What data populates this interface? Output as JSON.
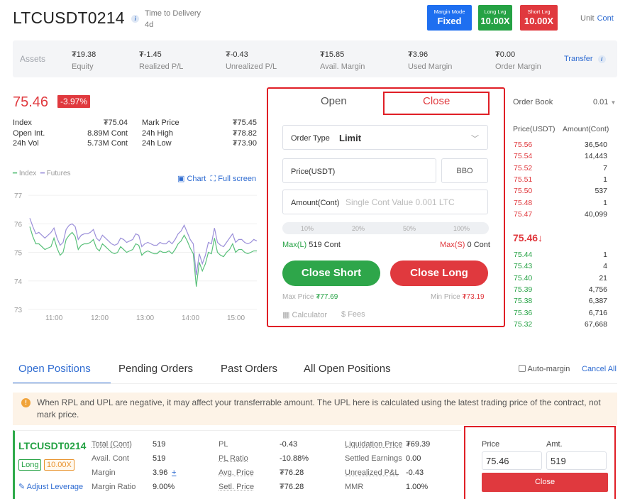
{
  "header": {
    "symbol": "LTCUSDT0214",
    "time_label": "Time to Delivery",
    "time_value": "4d",
    "margin_mode_label": "Margin Mode",
    "margin_mode_value": "Fixed",
    "long_lvg_label": "Long Lvg",
    "long_lvg_value": "10.00X",
    "short_lvg_label": "Short Lvg",
    "short_lvg_value": "10.00X",
    "unit_label": "Unit",
    "unit_value": "Cont"
  },
  "assets": {
    "label": "Assets",
    "items": [
      {
        "value": "₮19.38",
        "label": "Equity"
      },
      {
        "value": "₮-1.45",
        "label": "Realized P/L"
      },
      {
        "value": "₮-0.43",
        "label": "Unrealized P/L"
      },
      {
        "value": "₮15.85",
        "label": "Avail. Margin"
      },
      {
        "value": "₮3.96",
        "label": "Used Margin"
      },
      {
        "value": "₮0.00",
        "label": "Order Margin"
      }
    ],
    "transfer": "Transfer"
  },
  "ticker": {
    "price": "75.46",
    "change": "-3.97%",
    "index_label": "Index",
    "index": "₮75.04",
    "mark_label": "Mark Price",
    "mark": "₮75.45",
    "oi_label": "Open Int.",
    "oi": "8.89M Cont",
    "high_label": "24h High",
    "high": "₮78.82",
    "vol_label": "24h Vol",
    "vol": "5.73M Cont",
    "low_label": "24h Low",
    "low": "₮73.90"
  },
  "chart_legend": {
    "index": "Index",
    "futures": "Futures",
    "chart": "Chart",
    "fullscreen": "Full screen"
  },
  "chart_data": {
    "type": "line",
    "x": [
      "11:00",
      "12:00",
      "13:00",
      "14:00",
      "15:00"
    ],
    "yticks": [
      "77",
      "76",
      "75",
      "74",
      "73"
    ],
    "ylim": [
      73,
      77.3
    ],
    "series": [
      {
        "name": "Index",
        "color": "#59c07a",
        "values": [
          75.9,
          75.55,
          75.3,
          75.3,
          75.2,
          75.1,
          75.15,
          75.2,
          75.5,
          75.15,
          74.9,
          75.0,
          75.45,
          75.6,
          75.7,
          75.55,
          75.1,
          75.25,
          75.3,
          75.3,
          75.35,
          75.45,
          75.15,
          75.05,
          75.3,
          75.2,
          75.1,
          75.0,
          74.95,
          75.0,
          75.2,
          75.1,
          75.0,
          75.05,
          75.1,
          75.3,
          75.25,
          74.9,
          75.0,
          75.05,
          75.0,
          74.95,
          74.95,
          75.05,
          75.0,
          75.0,
          75.05,
          74.95,
          75.1,
          75.3,
          75.4,
          75.6,
          75.4,
          75.15,
          74.95,
          73.8,
          74.65,
          74.35,
          74.6,
          75.0,
          74.95,
          75.5,
          75.0,
          74.9,
          74.85,
          75.0,
          75.1,
          75.3,
          75.0,
          75.1,
          75.1,
          75.0,
          74.95,
          75.0,
          75.05,
          75.05
        ]
      },
      {
        "name": "Futures",
        "color": "#9b8fd9",
        "values": [
          76.2,
          75.9,
          75.65,
          75.7,
          75.6,
          75.5,
          75.6,
          75.7,
          75.85,
          75.5,
          75.25,
          75.35,
          75.8,
          75.95,
          76.0,
          75.9,
          75.45,
          75.6,
          75.65,
          75.65,
          75.7,
          75.8,
          75.5,
          75.4,
          75.6,
          75.5,
          75.4,
          75.3,
          75.25,
          75.3,
          75.5,
          75.45,
          75.35,
          75.4,
          75.45,
          75.65,
          75.6,
          75.2,
          75.3,
          75.35,
          75.3,
          75.25,
          75.25,
          75.35,
          75.3,
          75.3,
          75.4,
          75.3,
          75.45,
          75.65,
          75.75,
          75.95,
          75.7,
          75.45,
          75.3,
          74.2,
          74.95,
          74.6,
          74.9,
          75.35,
          75.3,
          75.85,
          75.35,
          75.25,
          75.2,
          75.35,
          75.5,
          75.65,
          75.35,
          75.45,
          75.45,
          75.35,
          75.3,
          75.35,
          75.45,
          75.4
        ]
      }
    ]
  },
  "order_panel": {
    "tab_open": "Open",
    "tab_close": "Close",
    "order_type_label": "Order Type",
    "order_type_value": "Limit",
    "price_label": "Price(USDT)",
    "bbo": "BBO",
    "amount_label": "Amount(Cont)",
    "amount_placeholder": "Single Cont Value 0.001 LTC",
    "pcts": [
      "10%",
      "20%",
      "50%",
      "100%"
    ],
    "max_l_label": "Max(L)",
    "max_l": "519 Cont",
    "max_s_label": "Max(S)",
    "max_s": "0 Cont",
    "close_short": "Close Short",
    "close_long": "Close Long",
    "max_price_label": "Max Price",
    "max_price": "₮77.69",
    "min_price_label": "Min Price",
    "min_price": "₮73.19",
    "calculator": "Calculator",
    "fees": "Fees"
  },
  "order_book": {
    "title": "Order Book",
    "precision": "0.01",
    "col_price": "Price(USDT)",
    "col_amount": "Amount(Cont)",
    "asks": [
      [
        "75.56",
        "36,540"
      ],
      [
        "75.54",
        "14,443"
      ],
      [
        "75.52",
        "7"
      ],
      [
        "75.51",
        "1"
      ],
      [
        "75.50",
        "537"
      ],
      [
        "75.48",
        "1"
      ],
      [
        "75.47",
        "40,099"
      ]
    ],
    "last": "75.46",
    "bids": [
      [
        "75.44",
        "1"
      ],
      [
        "75.43",
        "4"
      ],
      [
        "75.40",
        "21"
      ],
      [
        "75.39",
        "4,756"
      ],
      [
        "75.38",
        "6,387"
      ],
      [
        "75.36",
        "6,716"
      ],
      [
        "75.32",
        "67,668"
      ]
    ]
  },
  "positions": {
    "tabs": [
      "Open Positions",
      "Pending Orders",
      "Past Orders",
      "All Open Positions"
    ],
    "auto_margin": "Auto-margin",
    "cancel_all": "Cancel All",
    "notice": "When RPL and UPL are negative, it may affect your transferrable amount. The UPL here is calculated using the latest trading price of the contract, not mark price.",
    "symbol": "LTCUSDT0214",
    "side": "Long",
    "lev": "10.00X",
    "adjust": "Adjust Leverage",
    "fields": [
      [
        [
          "Total (Cont)",
          "519"
        ],
        [
          "Avail. Cont",
          "519"
        ],
        [
          "Margin",
          "3.96"
        ],
        [
          "Margin Ratio",
          "9.00%"
        ]
      ],
      [
        [
          "PL",
          "-0.43"
        ],
        [
          "PL Ratio",
          "-10.88%"
        ],
        [
          "Avg. Price",
          "₮76.28"
        ],
        [
          "Setl. Price",
          "₮76.28"
        ]
      ],
      [
        [
          "Liquidation Price",
          "₮69.39"
        ],
        [
          "Settled Earnings",
          "0.00"
        ],
        [
          "Unrealized P&L",
          "-0.43"
        ],
        [
          "MMR",
          "1.00%"
        ]
      ]
    ],
    "margin_plus": "+",
    "close_form": {
      "price_label": "Price",
      "amt_label": "Amt.",
      "price": "75.46",
      "amt": "519",
      "button": "Close"
    }
  }
}
